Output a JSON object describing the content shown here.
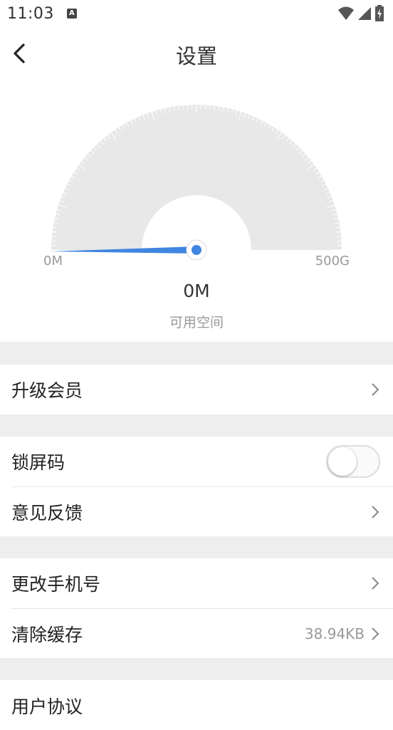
{
  "status_bar": {
    "time": "11:03",
    "notification_icon": "A"
  },
  "header": {
    "back_icon": "chevron-left-icon",
    "title": "设置"
  },
  "storage_gauge": {
    "min_label": "0M",
    "max_label": "500G",
    "value": "0M",
    "caption": "可用空间",
    "fill_fraction": 0,
    "accent_color": "#3f86e0"
  },
  "sections": [
    {
      "items": [
        {
          "label": "升级会员",
          "type": "link"
        }
      ]
    },
    {
      "items": [
        {
          "label": "锁屏码",
          "type": "toggle",
          "checked": false
        },
        {
          "label": "意见反馈",
          "type": "link"
        }
      ]
    },
    {
      "items": [
        {
          "label": "更改手机号",
          "type": "link"
        },
        {
          "label": "清除缓存",
          "type": "link",
          "value": "38.94KB"
        }
      ]
    },
    {
      "items": [
        {
          "label": "用户协议",
          "type": "link"
        }
      ]
    }
  ]
}
